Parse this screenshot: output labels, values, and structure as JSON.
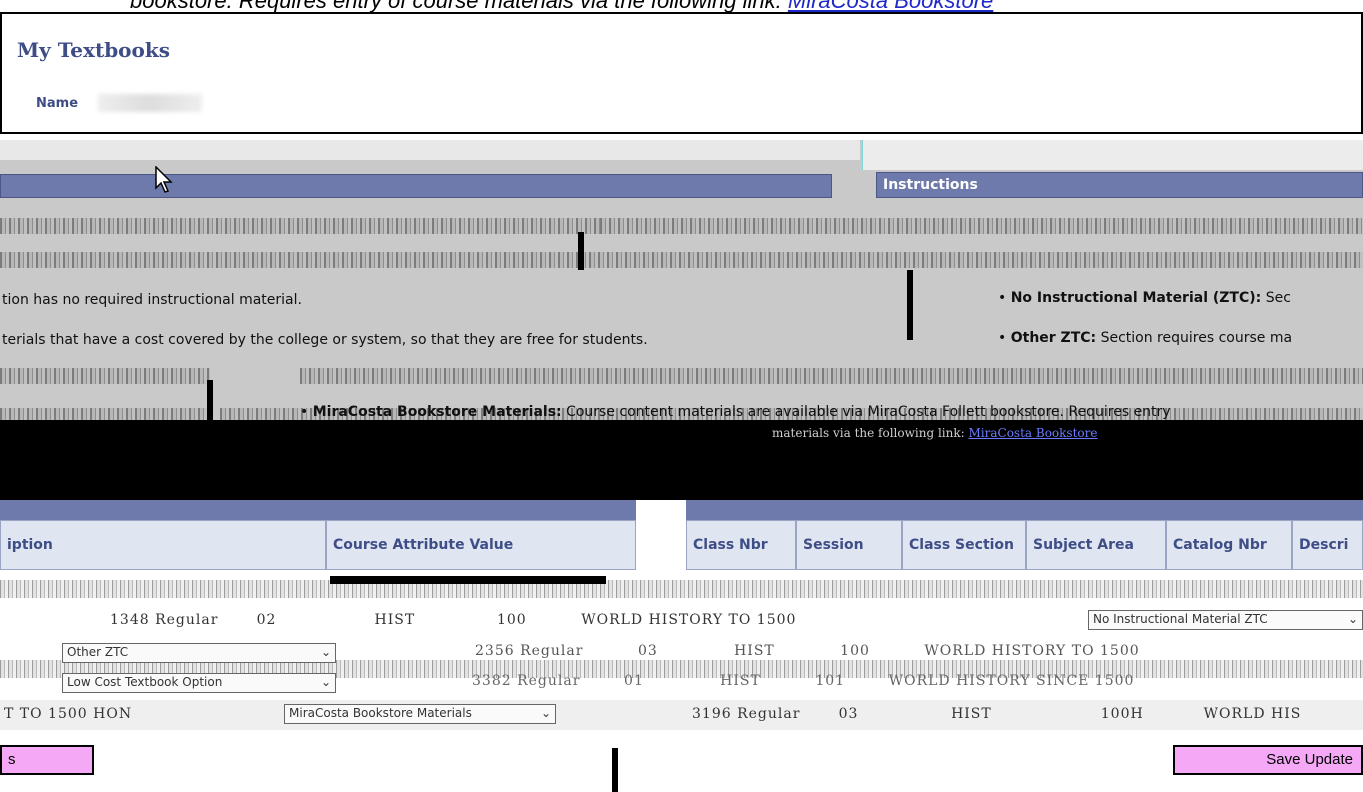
{
  "banner": {
    "text": "bookstore. Requires entry of course materials via the following link:",
    "link": "MiraCosta Bookstore"
  },
  "header": {
    "title": "My Textbooks",
    "name_label": "Name"
  },
  "instructions": {
    "title": "Instructions"
  },
  "options": {
    "no_required": "tion has no required instructional material.",
    "cost_covered": "terials that have a cost covered by the college or system, so that they are free for students.",
    "bullet_no_material_label": "No Instructional Material (ZTC):",
    "bullet_no_material_rest": "Sec",
    "bullet_other_label": "Other ZTC:",
    "bullet_other_rest": "Section requires course ma",
    "bullet_miracosta_label": "MiraCosta Bookstore Materials:",
    "bullet_miracosta_rest": "Course content materials are available via MiraCosta Follett bookstore. Requires entry",
    "black_band_text": "materials via the following link:",
    "black_band_link": "MiraCosta Bookstore"
  },
  "left_table": {
    "headers": [
      "iption",
      "Course Attribute Value"
    ]
  },
  "right_table": {
    "headers": [
      "Class Nbr",
      "Session",
      "Class Section",
      "Subject Area",
      "Catalog Nbr",
      "Descri"
    ]
  },
  "rows": [
    {
      "class_nbr": "1348",
      "session": "Regular",
      "section": "02",
      "subject": "HIST",
      "catalog": "100",
      "description": "WORLD HISTORY TO 1500",
      "select": "No Instructional Material ZTC"
    },
    {
      "select_left": "Other ZTC",
      "class_nbr": "2356",
      "session": "Regular",
      "section": "03",
      "subject": "HIST",
      "catalog": "100",
      "description": "WORLD HISTORY TO 1500"
    },
    {
      "select_left": "Low Cost Textbook Option",
      "class_nbr": "3382",
      "session": "Regular",
      "section": "01",
      "subject": "HIST",
      "catalog": "101",
      "description": "WORLD HISTORY SINCE 1500"
    },
    {
      "desc_left": "T TO 1500 HON",
      "select_left": "MiraCosta Bookstore Materials",
      "class_nbr": "3196",
      "session": "Regular",
      "section": "03",
      "subject": "HIST",
      "catalog": "100H",
      "description": "WORLD HIS"
    }
  ],
  "buttons": {
    "left_label": "s",
    "save_label": "Save Update"
  }
}
